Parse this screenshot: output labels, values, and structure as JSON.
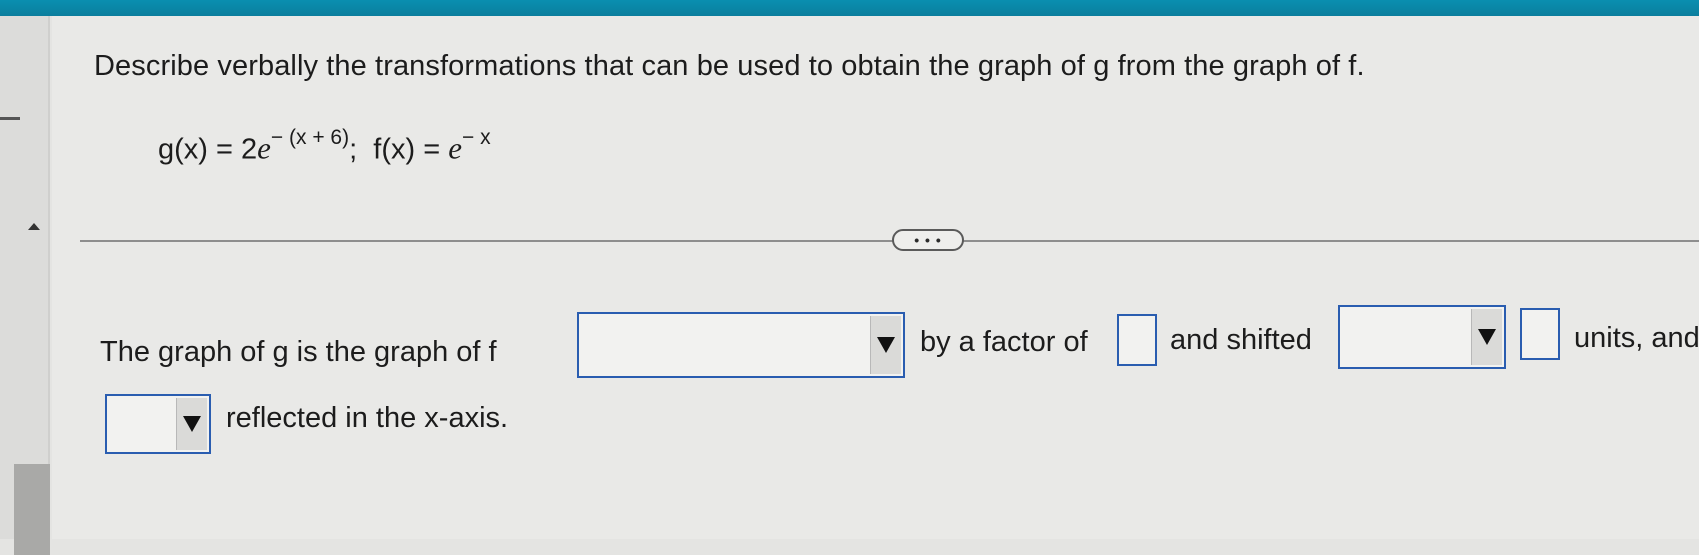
{
  "question": {
    "instruction": "Describe verbally the transformations that can be used to obtain the graph of g from the graph of f.",
    "g_lhs": "g(x) = 2",
    "g_base": "e",
    "g_exponent": "− (x + 6)",
    "separator": ";",
    "f_lhs": "f(x) = ",
    "f_base": "e",
    "f_exponent": "− x"
  },
  "more_button": {
    "label": "• • •"
  },
  "answer_sentence": {
    "part1": "The graph of g is the graph of f",
    "part2": "by a factor of",
    "part3": "and shifted",
    "part4": "units, and",
    "part5": "reflected in the x-axis."
  },
  "inputs": {
    "transformation_dropdown": "",
    "factor_value": "",
    "shift_direction_dropdown": "",
    "shift_units_value": "",
    "reflection_dropdown": ""
  },
  "colors": {
    "top_bar": "#0b87a8",
    "input_border": "#2a5db0"
  }
}
